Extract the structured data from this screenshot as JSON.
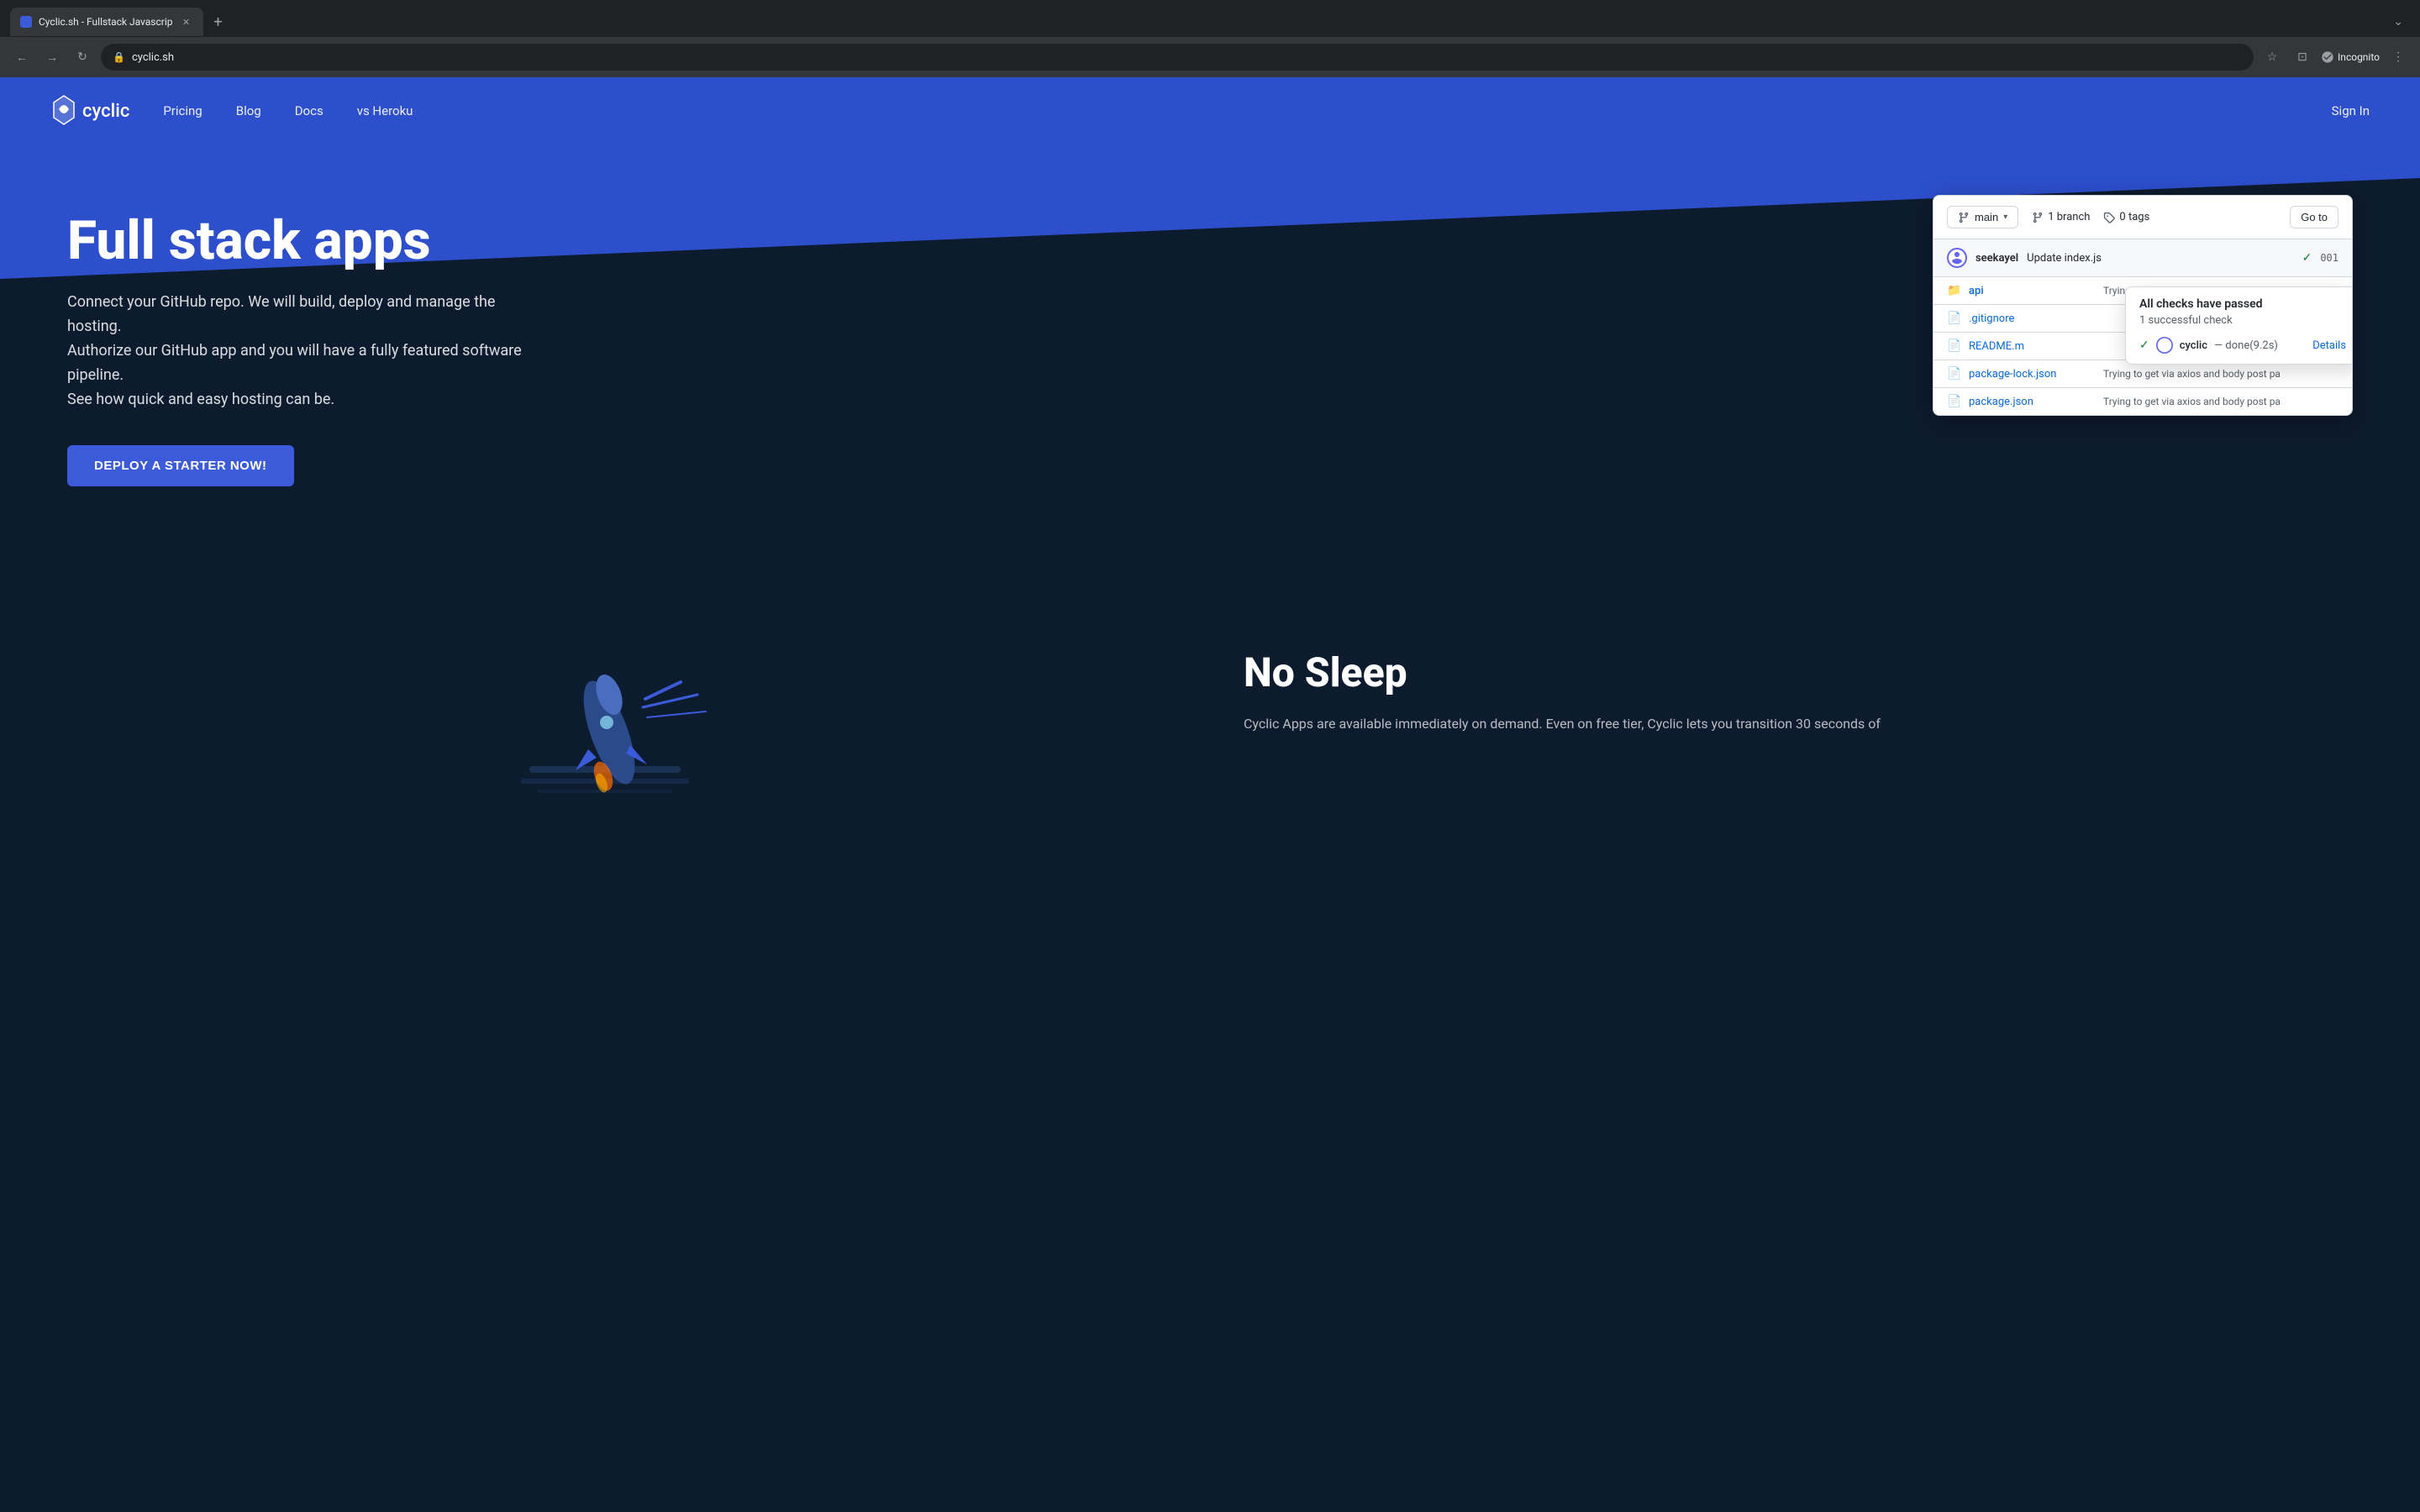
{
  "browser": {
    "tab_title": "Cyclic.sh - Fullstack Javascrip",
    "url": "cyclic.sh",
    "incognito_label": "Incognito"
  },
  "site": {
    "logo_text": "cyclic",
    "nav": {
      "pricing": "Pricing",
      "blog": "Blog",
      "docs": "Docs",
      "vs_heroku": "vs Heroku"
    },
    "sign_in": "Sign In"
  },
  "hero": {
    "title": "Full stack apps",
    "subtitle_line1": "Connect your GitHub repo. We will build, deploy and manage the hosting.",
    "subtitle_line2": "Authorize our GitHub app and you will have a fully featured software pipeline.",
    "subtitle_line3": "See how quick and easy hosting can be.",
    "cta": "DEPLOY A STARTER NOW!"
  },
  "github_widget": {
    "branch_btn": "main",
    "branch_count_label": "1 branch",
    "tag_count_label": "0 tags",
    "go_to_label": "Go to",
    "commit": {
      "user": "seekayel",
      "message": "Update index.js",
      "hash": "001",
      "check_icon": "✓"
    },
    "checks_popup": {
      "title": "All checks have passed",
      "subtitle": "1 successful check",
      "item": {
        "app": "cyclic",
        "status": "— done(9.2s)",
        "details": "Details"
      }
    },
    "files": [
      {
        "type": "folder",
        "name": "api",
        "commit": "Trying to get via axios and body post pa"
      },
      {
        "type": "file",
        "name": ".gitignore",
        "commit": ""
      },
      {
        "type": "file",
        "name": "README.m",
        "commit": ""
      },
      {
        "type": "file",
        "name": "package-lock.json",
        "commit": "Trying to get via axios and body post pa"
      },
      {
        "type": "file",
        "name": "package.json",
        "commit": "Trying to get via axios and body post pa"
      }
    ]
  },
  "no_sleep": {
    "title": "No Sleep",
    "text": "Cyclic Apps are available immediately on demand. Even on free tier, Cyclic lets you transition 30 seconds of"
  }
}
